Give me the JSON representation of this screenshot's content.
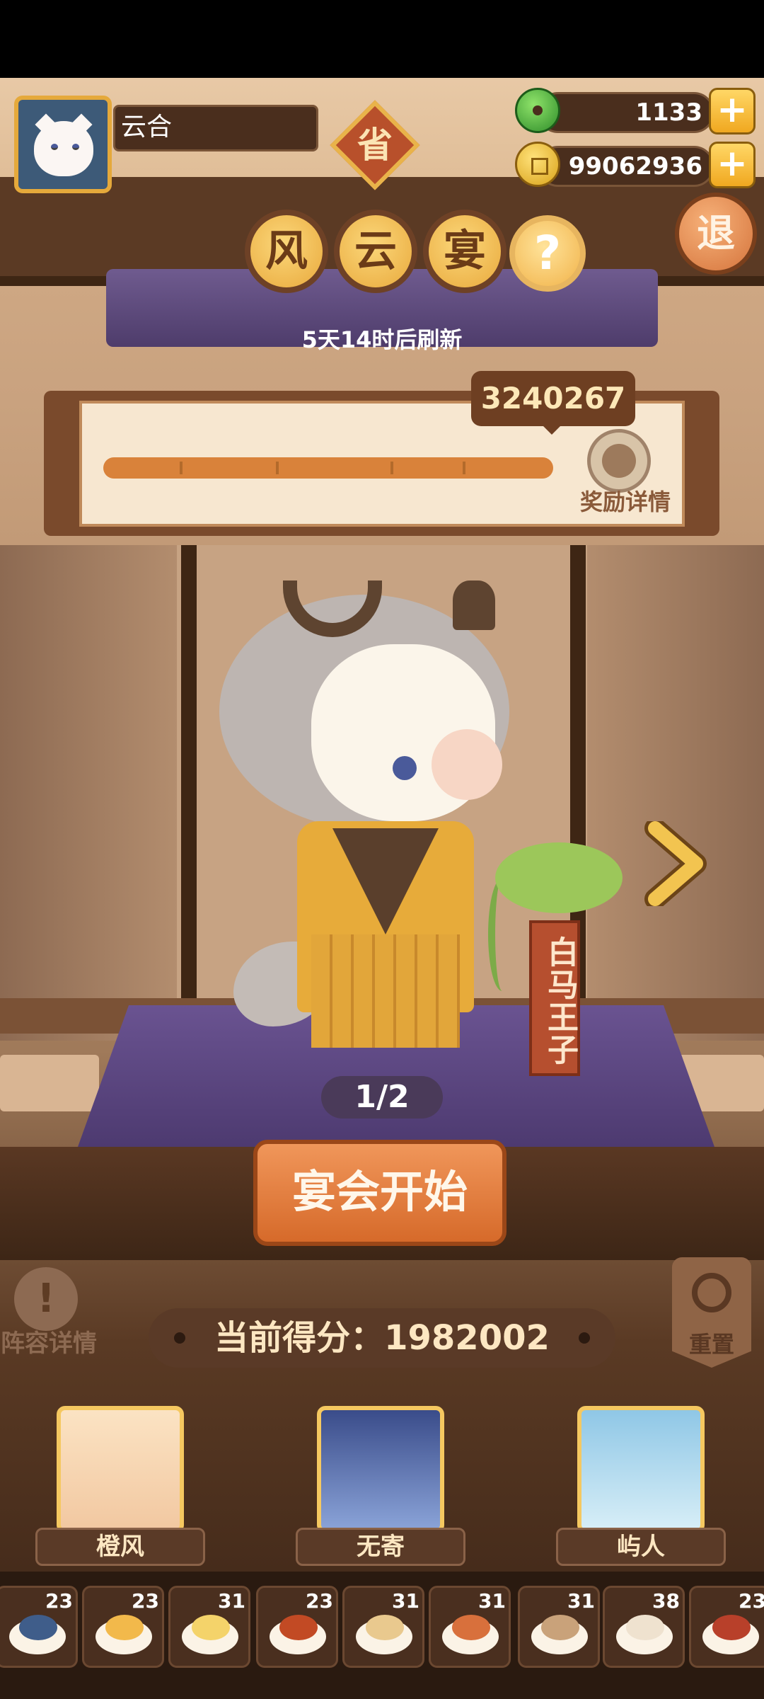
{
  "player": {
    "name": "云合"
  },
  "province_badge": "省",
  "currency": {
    "jade": "1133",
    "coins": "99062936",
    "plus": "+"
  },
  "quit_label": "退",
  "title": [
    "风",
    "云",
    "宴"
  ],
  "help_label": "?",
  "refresh_text": "5天14时后刷新",
  "progress": {
    "score": "3240267",
    "reward_details": "奖励详情",
    "fill": 1.0
  },
  "character": {
    "name": "白马王子",
    "pager": "1/2"
  },
  "start_button": "宴会开始",
  "lineup_details": "阵容详情",
  "lineup_icon": "!",
  "reset_label": "重置",
  "current_score": "当前得分：1982002",
  "heroes": [
    {
      "name": "橙风"
    },
    {
      "name": "无寄"
    },
    {
      "name": "屿人"
    }
  ],
  "dishes": [
    "23",
    "23",
    "31",
    "23",
    "31",
    "31",
    "31",
    "38",
    "23"
  ],
  "colors": {
    "accent": "#d66a2a",
    "gold": "#f5c860",
    "panel": "#5a3a27"
  }
}
